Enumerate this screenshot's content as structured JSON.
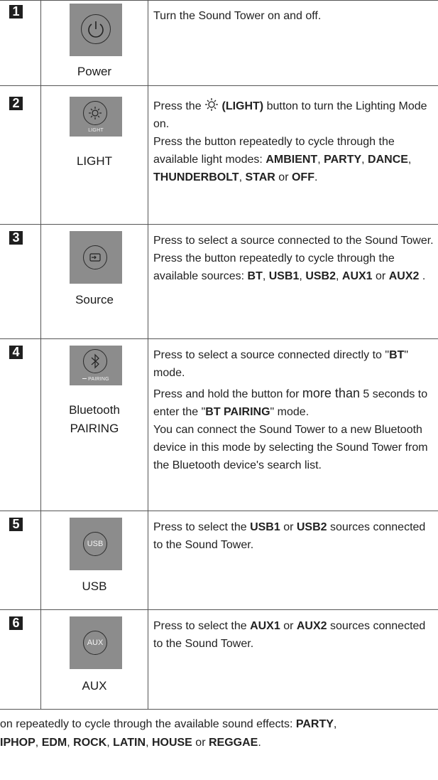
{
  "rows": [
    {
      "number": "1",
      "label": "Power",
      "icon": "power-icon",
      "description": [
        "Turn the Sound Tower on and off."
      ]
    },
    {
      "number": "2",
      "label": "LIGHT",
      "button_text": "LIGHT",
      "icon": "light-icon",
      "description": [
        "Press the ☼ (LIGHT) button to turn the Lighting Mode on.",
        "Press the button repeatedly to cycle through the available light modes: AMBIENT, PARTY, DANCE, THUNDERBOLT, STAR or OFF."
      ],
      "desc_parts": {
        "pre": "Press the ",
        "light_bold": "(LIGHT)",
        "post": " button to turn the Lighting Mode on.",
        "line2": "Press the button repeatedly to cycle through the available light modes: ",
        "modes": [
          "AMBIENT",
          "PARTY",
          "DANCE",
          "THUNDERBOLT",
          "STAR",
          "OFF"
        ],
        "or": " or "
      }
    },
    {
      "number": "3",
      "label": "Source",
      "icon": "source-icon",
      "desc_parts": {
        "line1": "Press to select a source connected to the Sound Tower.",
        "line2": "Press the button repeatedly to cycle through the available sources: ",
        "sources": [
          "BT",
          "USB1",
          "USB2",
          "AUX1",
          "AUX2"
        ],
        "or": " or "
      }
    },
    {
      "number": "4",
      "label_line1": "Bluetooth",
      "label_line2": "PAIRING",
      "button_text": "PAIRING",
      "icon": "bluetooth-icon",
      "desc_parts": {
        "line1_pre": "Press to select a source connected directly to \"",
        "line1_bold": "BT",
        "line1_post": "\" mode.",
        "line2_pre": "Press and hold the button for ",
        "line2_more": "more than",
        "line2_mid": " 5 seconds to enter the \"",
        "line2_bold": "BT PAIRING",
        "line2_post": "\" mode.",
        "line3": "You can connect the Sound Tower to a new Bluetooth device in this mode by selecting the Sound Tower from the Bluetooth device's search list."
      }
    },
    {
      "number": "5",
      "label": "USB",
      "button_text": "USB",
      "icon": "usb-icon",
      "desc_parts": {
        "pre": "Press to select the ",
        "a": "USB1",
        "or": " or ",
        "b": "USB2",
        "post": " sources connected to the Sound Tower."
      }
    },
    {
      "number": "6",
      "label": "AUX",
      "button_text": "AUX",
      "icon": "aux-icon",
      "desc_parts": {
        "pre": "Press to select the ",
        "a": "AUX1",
        "or": " or ",
        "b": "AUX2",
        "post": " sources connected to the Sound Tower."
      }
    }
  ],
  "footer": {
    "line1_pre": "on repeatedly to cycle through the available sound effects: ",
    "line1_bold": "PARTY",
    "line1_post": ",",
    "line2_items": [
      "IPHOP",
      "EDM",
      "ROCK",
      "LATIN",
      "HOUSE"
    ],
    "line2_or": " or ",
    "line2_last": "REGGAE",
    "line2_end": "."
  },
  "colors": {
    "button_bg": "#8c8c8c",
    "number_bg": "#1f1f1f",
    "grid": "#555555"
  }
}
